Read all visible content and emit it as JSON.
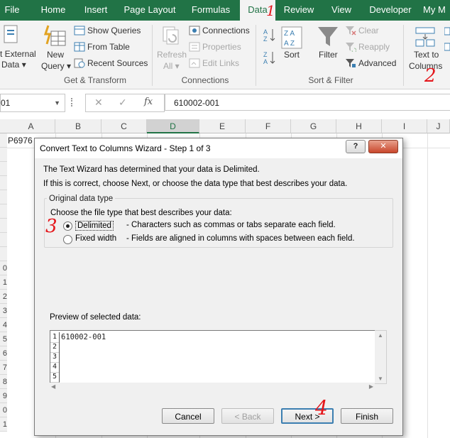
{
  "ribbon_tabs": [
    {
      "label": "File",
      "active": false
    },
    {
      "label": "Home",
      "active": false
    },
    {
      "label": "Insert",
      "active": false
    },
    {
      "label": "Page Layout",
      "active": false
    },
    {
      "label": "Formulas",
      "active": false
    },
    {
      "label": "Data",
      "active": true
    },
    {
      "label": "Review",
      "active": false
    },
    {
      "label": "View",
      "active": false
    },
    {
      "label": "Developer",
      "active": false
    },
    {
      "label": "My M",
      "active": false
    }
  ],
  "ribbon": {
    "get_external_data": {
      "line1": "t External",
      "line2": "Data"
    },
    "new_query": {
      "line1": "New",
      "line2": "Query"
    },
    "show_queries": "Show Queries",
    "from_table": "From Table",
    "recent_sources": "Recent Sources",
    "group_get_transform": "Get & Transform",
    "refresh_all": {
      "line1": "Refresh",
      "line2": "All"
    },
    "connections": "Connections",
    "properties": "Properties",
    "edit_links": "Edit Links",
    "group_connections": "Connections",
    "sort": "Sort",
    "filter": "Filter",
    "clear": "Clear",
    "reapply": "Reapply",
    "advanced": "Advanced",
    "group_sort_filter": "Sort & Filter",
    "text_to_columns": {
      "line1": "Text to",
      "line2": "Columns"
    }
  },
  "formula_bar": {
    "name_box": "01",
    "fx": "fx",
    "content": "610002-001"
  },
  "columns": [
    "A",
    "B",
    "C",
    "D",
    "E",
    "F",
    "G",
    "H",
    "I",
    "J"
  ],
  "selected_column": "D",
  "cell_a1": "P6976",
  "row_numbers": [
    "",
    "",
    "",
    "",
    "",
    "",
    "",
    "",
    "",
    "0",
    "1",
    "2",
    "3",
    "4",
    "5",
    "6",
    "7",
    "8",
    "9",
    "0",
    "1"
  ],
  "dialog": {
    "title": "Convert Text to Columns Wizard - Step 1 of 3",
    "help_label": "?",
    "close_label": "✕",
    "intro1": "The Text Wizard has determined that your data is Delimited.",
    "intro2": "If this is correct, choose Next, or choose the data type that best describes your data.",
    "group_label": "Original data type",
    "choose_label": "Choose the file type that best describes your data:",
    "options": [
      {
        "label": "Delimited",
        "desc": "- Characters such as commas or tabs separate each field.",
        "selected": true
      },
      {
        "label": "Fixed width",
        "desc": "- Fields are aligned in columns with spaces between each field.",
        "selected": false
      }
    ],
    "preview_label": "Preview of selected data:",
    "preview_rows": [
      {
        "num": "1",
        "text": "610002-001"
      },
      {
        "num": "2",
        "text": ""
      },
      {
        "num": "3",
        "text": ""
      },
      {
        "num": "4",
        "text": ""
      },
      {
        "num": "5",
        "text": ""
      }
    ],
    "buttons": {
      "cancel": "Cancel",
      "back": "< Back",
      "next": "Next >",
      "finish": "Finish"
    }
  },
  "annotations": [
    "1",
    "2",
    "3",
    "4"
  ],
  "colors": {
    "ribbon_green": "#217346",
    "annotation_red": "#e4161b"
  }
}
